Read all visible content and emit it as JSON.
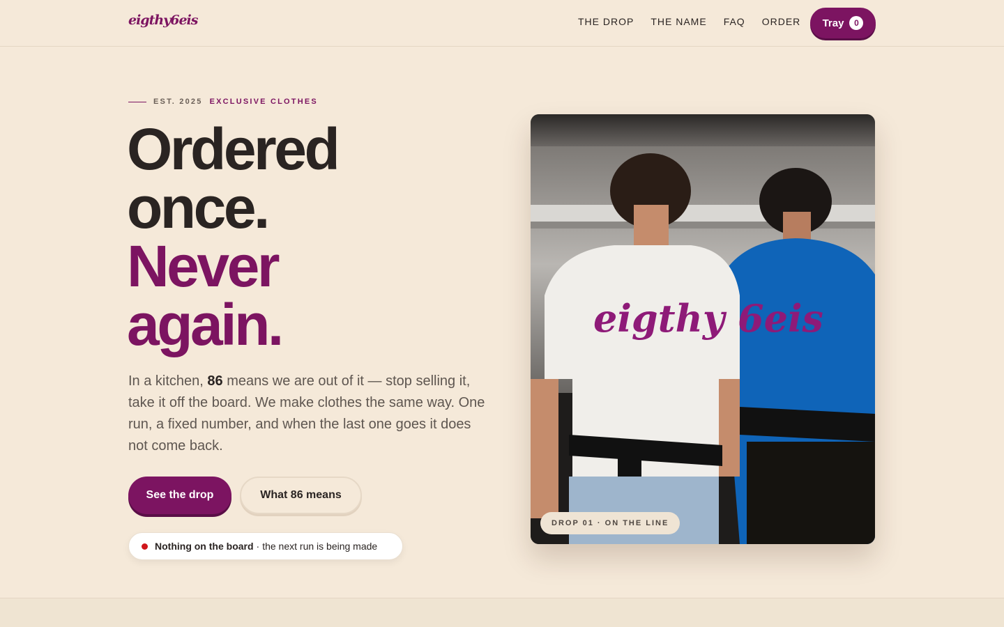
{
  "brand": {
    "logo_text": "eigthy6eis"
  },
  "nav": {
    "links": [
      "THE DROP",
      "THE NAME",
      "FAQ",
      "ORDER"
    ],
    "tray_label": "Tray",
    "tray_count": "0"
  },
  "hero": {
    "eyebrow_est": "EST. 2025",
    "eyebrow_tag": "EXCLUSIVE CLOTHES",
    "headline_line1": "Ordered",
    "headline_line2": "once.",
    "headline_line3": "Never",
    "headline_line4": "again.",
    "lede_prefix": "In a kitchen,",
    "lede_bold": "86",
    "lede_suffix": "means we are out of it — stop selling it, take it off the board. We make clothes the same way. One run, a fixed number, and when the last one goes it does not come back.",
    "primary_cta": "See the drop",
    "secondary_cta": "What 86 means",
    "status_bold": "Nothing on the board",
    "status_sep": "·",
    "status_text": "the next run is being made",
    "image_badge": "DROP 01 · ON THE LINE",
    "shirt_print": "eigthy 6eis"
  },
  "colors": {
    "background": "#f5e9d9",
    "accent": "#7c1461",
    "text": "#2a2422",
    "status_dot": "#d0161b"
  }
}
